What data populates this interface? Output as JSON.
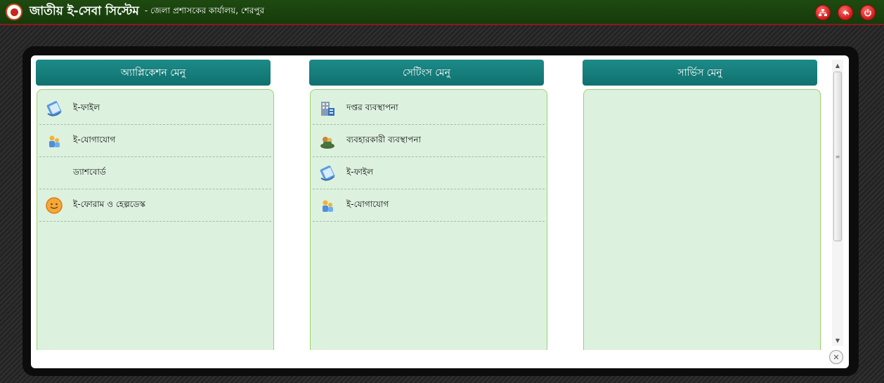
{
  "header": {
    "title": "জাতীয় ই-সেবা সিস্টেম",
    "subtitle": "- জেলা প্রশাসকের কার্যালয়, শেরপুর",
    "icons": [
      "sitemap-icon",
      "back-icon",
      "power-icon"
    ]
  },
  "columns": [
    {
      "title": "অ্যাপ্লিকেশন মেনু",
      "items": [
        {
          "label": "ই-ফাইল",
          "icon": "efile-icon"
        },
        {
          "label": "ই-যোগাযোগ",
          "icon": "communication-icon"
        },
        {
          "label": "ড্যাশবোর্ড",
          "icon": ""
        },
        {
          "label": "ই-ফোরাম ও হেল্পডেস্ক",
          "icon": "forum-icon"
        }
      ]
    },
    {
      "title": "সেটিংস মেনু",
      "items": [
        {
          "label": "দপ্তর ব্যবস্থাপনা",
          "icon": "office-icon"
        },
        {
          "label": "ব্যবহারকারী ব্যবস্থাপনা",
          "icon": "users-icon"
        },
        {
          "label": "ই-ফাইল",
          "icon": "efile-icon"
        },
        {
          "label": "ই-যোগাযোগ",
          "icon": "communication-icon"
        }
      ]
    },
    {
      "title": "সার্ভিস মেনু",
      "items": []
    }
  ],
  "colors": {
    "topbar": "#1e4a10",
    "column_header": "#1d8b88",
    "column_body": "#ddf1df",
    "icon_red": "#d11a1a"
  }
}
